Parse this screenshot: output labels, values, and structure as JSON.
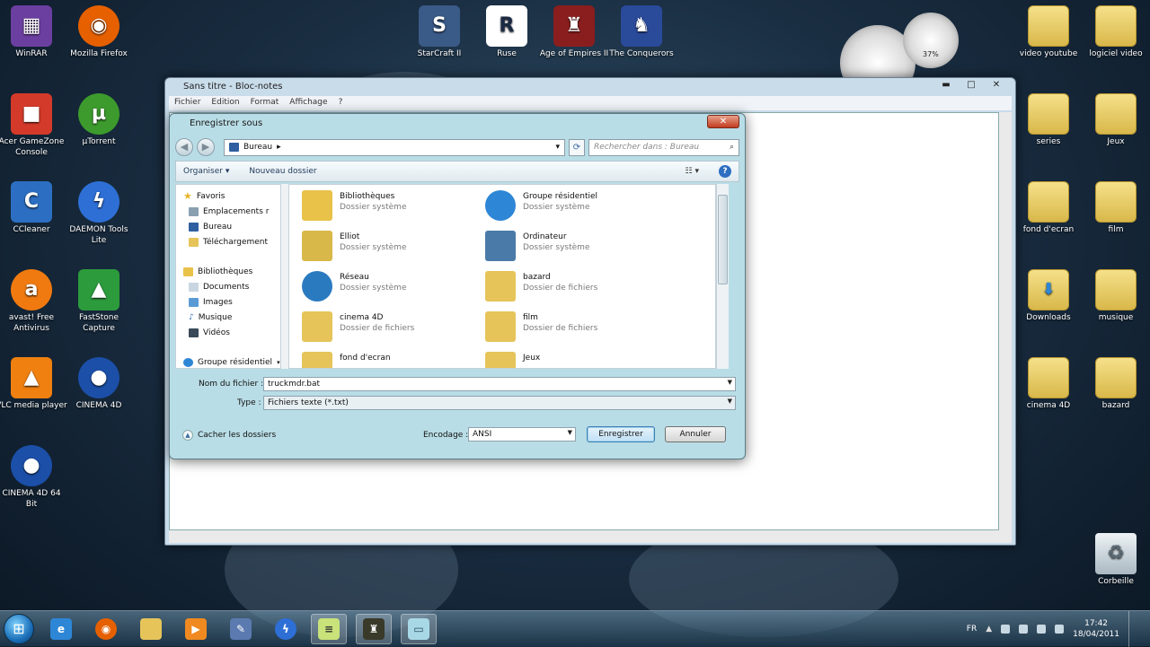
{
  "desktop": {
    "left_icons": [
      {
        "label": "WinRAR",
        "icon": "winrar-icon",
        "color": "#6b3fa0"
      },
      {
        "label": "Mozilla Firefox",
        "icon": "firefox-icon",
        "color": "#e66000"
      },
      {
        "label": "Acer GameZone Console",
        "icon": "gamezone-icon",
        "color": "#d43a2a"
      },
      {
        "label": "µTorrent",
        "icon": "utorrent-icon",
        "color": "#3c9b2c"
      },
      {
        "label": "CCleaner",
        "icon": "ccleaner-icon",
        "color": "#2c6fc2"
      },
      {
        "label": "DAEMON Tools Lite",
        "icon": "daemon-tools-icon",
        "color": "#2e6fd6"
      },
      {
        "label": "avast! Free Antivirus",
        "icon": "avast-icon",
        "color": "#f07a10"
      },
      {
        "label": "FastStone Capture",
        "icon": "faststone-icon",
        "color": "#2c9b3c"
      },
      {
        "label": "VLC media player",
        "icon": "vlc-icon",
        "color": "#f08010"
      },
      {
        "label": "CINEMA 4D",
        "icon": "cinema4d-icon",
        "color": "#1b4fa8"
      },
      {
        "label": "CINEMA 4D 64 Bit",
        "icon": "cinema4d-64-icon",
        "color": "#1b4fa8"
      }
    ],
    "top_icons": [
      {
        "label": "StarCraft II",
        "icon": "starcraft-icon",
        "color": "#3a5a88"
      },
      {
        "label": "Ruse",
        "icon": "ruse-icon",
        "color": "#ffffff"
      },
      {
        "label": "Age of Empires II",
        "icon": "age-of-empires-icon",
        "color": "#8a1e1e"
      },
      {
        "label": "The Conquerors",
        "icon": "conquerors-icon",
        "color": "#2a4a9a"
      }
    ],
    "right_icons": [
      {
        "label": "video youtube"
      },
      {
        "label": "logiciel video"
      },
      {
        "label": "series"
      },
      {
        "label": "Jeux"
      },
      {
        "label": "fond d'ecran"
      },
      {
        "label": "film"
      },
      {
        "label": "Downloads"
      },
      {
        "label": "musique"
      },
      {
        "label": "cinema 4D"
      },
      {
        "label": "bazard"
      }
    ],
    "recycle_bin": {
      "label": "Corbeille"
    },
    "gadget": {
      "percent": "37%"
    }
  },
  "notepad": {
    "title": "Sans titre - Bloc-notes",
    "menu": [
      "Fichier",
      "Edition",
      "Format",
      "Affichage",
      "?"
    ],
    "controls": {
      "minimize": "▬",
      "maximize": "□",
      "close": "✕"
    }
  },
  "dialog": {
    "title": "Enregistrer sous",
    "close": "✕",
    "address": {
      "location": "Bureau",
      "sep": "▸"
    },
    "search_placeholder": "Rechercher dans : Bureau",
    "toolbar": {
      "organize": "Organiser ▾",
      "new_folder": "Nouveau dossier"
    },
    "nav_pane": {
      "favorites": "Favoris",
      "favorites_items": [
        "Emplacements r",
        "Bureau",
        "Téléchargement"
      ],
      "libraries": "Bibliothèques",
      "libraries_items": [
        "Documents",
        "Images",
        "Musique",
        "Vidéos"
      ],
      "homegroup": "Groupe résidentiel"
    },
    "files": [
      {
        "name": "Bibliothèques",
        "type": "Dossier système",
        "color": "#e9c24a"
      },
      {
        "name": "Groupe résidentiel",
        "type": "Dossier système",
        "color": "#2e86d6"
      },
      {
        "name": "Elliot",
        "type": "Dossier système",
        "color": "#d9b84a"
      },
      {
        "name": "Ordinateur",
        "type": "Dossier système",
        "color": "#4a7aa8"
      },
      {
        "name": "Réseau",
        "type": "Dossier système",
        "color": "#2a7ac0"
      },
      {
        "name": "bazard",
        "type": "Dossier de fichiers",
        "color": "#e6c45a"
      },
      {
        "name": "cinema 4D",
        "type": "Dossier de fichiers",
        "color": "#e6c45a"
      },
      {
        "name": "film",
        "type": "Dossier de fichiers",
        "color": "#e6c45a"
      },
      {
        "name": "fond d'ecran",
        "type": "",
        "color": "#e6c45a"
      },
      {
        "name": "Jeux",
        "type": "",
        "color": "#e6c45a"
      }
    ],
    "filename_label": "Nom du fichier :",
    "filename_value": "truckmdr.bat",
    "type_label": "Type :",
    "type_value": "Fichiers texte (*.txt)",
    "encoding_label": "Encodage :",
    "encoding_value": "ANSI",
    "save_button": "Enregistrer",
    "cancel_button": "Annuler",
    "hide_folders": "Cacher les dossiers"
  },
  "taskbar": {
    "language": "FR",
    "time": "17:42",
    "date": "18/04/2011",
    "pinned": [
      "internet-explorer-icon",
      "firefox-icon",
      "explorer-icon",
      "media-player-icon",
      "utility-icon",
      "daemon-tools-icon",
      "notepad-icon",
      "game-icon",
      "dialog-icon"
    ]
  }
}
